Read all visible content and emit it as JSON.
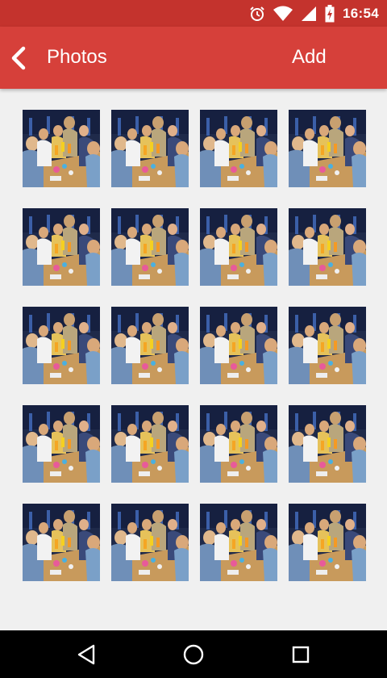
{
  "status_bar": {
    "time": "16:54",
    "icons": [
      "alarm-icon",
      "wifi-icon",
      "signal-icon",
      "battery-charging-icon"
    ]
  },
  "app_bar": {
    "title": "Photos",
    "action_label": "Add",
    "back_icon": "chevron-left-icon",
    "color": "#d6403a"
  },
  "photos": {
    "rows": 5,
    "columns": 4,
    "items": [
      "photo",
      "photo",
      "photo",
      "photo",
      "photo",
      "photo",
      "photo",
      "photo",
      "photo",
      "photo",
      "photo",
      "photo",
      "photo",
      "photo",
      "photo",
      "photo",
      "photo",
      "photo",
      "photo",
      "photo"
    ]
  },
  "nav_bar": {
    "icons": [
      "back-triangle-icon",
      "home-circle-icon",
      "recents-square-icon"
    ]
  }
}
